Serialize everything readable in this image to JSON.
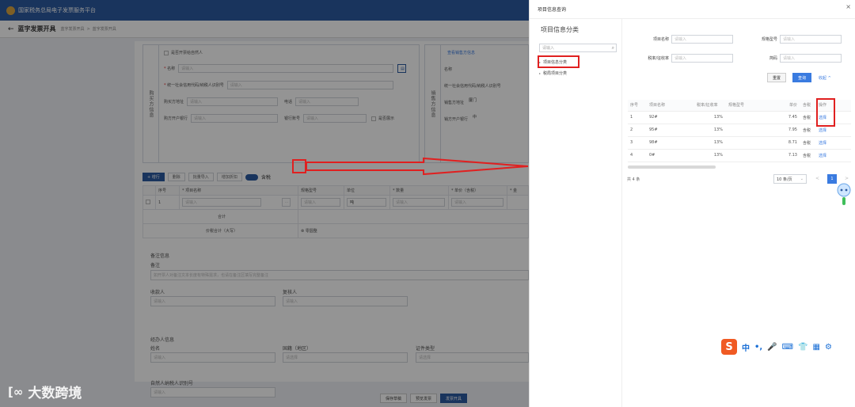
{
  "app": {
    "title": "国家税务总局电子发票服务平台"
  },
  "breadcrumb": {
    "title": "蓝字发票开具",
    "crumb1": "蓝字发票开具",
    "sep": ">",
    "crumb2": "蓝字发票开具"
  },
  "buyer": {
    "side_label": "购买方信息",
    "natural_person": "是否开票给自然人",
    "name_label": "名称",
    "name_placeholder": "请输入",
    "tax_id_label": "统一社会信用代码/纳税人识别号",
    "tax_id_placeholder": "请输入",
    "address_label": "购买方地址",
    "address_placeholder": "请输入",
    "phone_label": "电话",
    "phone_placeholder": "请输入",
    "bank_label": "购方开户银行",
    "bank_placeholder": "请输入",
    "account_label": "银行账号",
    "account_placeholder": "请输入",
    "show_label": "是否展示"
  },
  "seller": {
    "side_label": "销售方信息",
    "link": "查看销售方信息",
    "name_label": "名称",
    "name_value": "",
    "tax_id_label": "统一社会信用代码/纳税人识别号",
    "address_label": "销售方地址",
    "address_value": "厦门",
    "bank_label": "销方开户银行",
    "bank_value": "中"
  },
  "toolbar": {
    "add_row": "+ 增行",
    "delete": "删除",
    "tax_inclusive_label": "含税",
    "btn_a": "批量导入",
    "btn_b": "增加折扣"
  },
  "items_table": {
    "headers": [
      "序号",
      "* 项目名称",
      "规格型号",
      "单位",
      "* 数量",
      "* 单价（含税）",
      "* 金"
    ],
    "row": {
      "index": "1",
      "name_placeholder": "请输入",
      "spec_placeholder": "请输入",
      "unit": "吨",
      "qty_placeholder": "请输入",
      "price_placeholder": "请输入"
    },
    "subtotal_label": "合计",
    "total_label": "价税合计（大写）",
    "total_value": "⊗ 零圆整"
  },
  "remark": {
    "section": "备注信息",
    "remark_label": "备注",
    "remark_placeholder": "如开票人对备注文本长度有特殊需求，也请在备注区填写完整备注",
    "payee_label": "收款人",
    "payee_placeholder": "请输入",
    "reviewer_label": "复核人",
    "reviewer_placeholder": "请输入"
  },
  "handler": {
    "section": "经办人信息",
    "name_label": "姓名",
    "name_placeholder": "请输入",
    "country_label": "国籍（地区）",
    "country_placeholder": "请选择",
    "id_type_label": "证件类型",
    "id_type_placeholder": "请选择",
    "tax_id_label": "自然人纳税人识别号",
    "tax_id_placeholder": "请输入"
  },
  "bottom_buttons": [
    "保存草稿",
    "预览发票",
    "发票开具"
  ],
  "watermark": {
    "icon": "[∞",
    "text": "大数跨境"
  },
  "drawer": {
    "title": "项目信息查询",
    "close": "×",
    "category_title": "项目信息分类",
    "category_search_placeholder": "请输入",
    "tree": [
      "项目信息分类",
      "税局项目分类"
    ],
    "search": {
      "name_label": "项目名称",
      "name_placeholder": "请输入",
      "spec_label": "规格型号",
      "spec_placeholder": "请输入",
      "rate_label": "税率/征收率",
      "rate_placeholder": "请输入",
      "code_label": "简码",
      "code_placeholder": "请输入",
      "reset": "重置",
      "query": "查询",
      "collapse": "收起 ^"
    },
    "table": {
      "headers": [
        "序号",
        "项目名称",
        "税率/征收率",
        "规格型号",
        "单价",
        "含税",
        "操作"
      ],
      "rows": [
        {
          "idx": "1",
          "name": "92#",
          "rate": "13%",
          "spec": "",
          "price": "7.45",
          "tax": "含税",
          "op": "选择"
        },
        {
          "idx": "2",
          "name": "95#",
          "rate": "13%",
          "spec": "",
          "price": "7.95",
          "tax": "含税",
          "op": "选择"
        },
        {
          "idx": "3",
          "name": "98#",
          "rate": "13%",
          "spec": "",
          "price": "8.71",
          "tax": "含税",
          "op": "选择"
        },
        {
          "idx": "4",
          "name": "0#",
          "rate": "13%",
          "spec": "",
          "price": "7.13",
          "tax": "含税",
          "op": "选择"
        }
      ]
    },
    "pagination": {
      "total": "共 4 条",
      "page_size": "10 条/页",
      "current": "1",
      "prev": "<",
      "next": ">"
    }
  },
  "ime": {
    "logo": "S",
    "lang": "中",
    "punct": "•,",
    "mic": "🎤",
    "keyboard": "⌨",
    "skin": "👕",
    "apps": "▦",
    "settings": "⚙"
  },
  "colors": {
    "header_blue": "#2c5aa0",
    "link_blue": "#3a7be0",
    "highlight_red": "#e02020"
  }
}
